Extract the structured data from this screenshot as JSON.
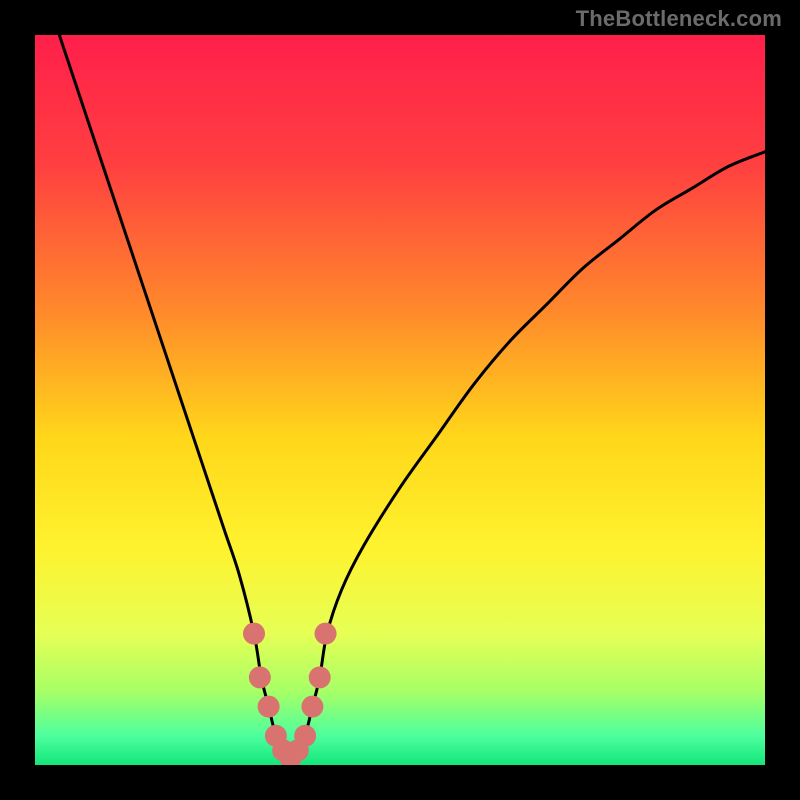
{
  "branding": {
    "text": "TheBottleneck.com"
  },
  "chart_data": {
    "type": "line",
    "title": "",
    "xlabel": "",
    "ylabel": "",
    "xlim": [
      0,
      100
    ],
    "ylim": [
      0,
      100
    ],
    "x": [
      0,
      2,
      4,
      6,
      8,
      10,
      12,
      14,
      16,
      18,
      20,
      22,
      24,
      26,
      28,
      30,
      31,
      32,
      33,
      34,
      35,
      36,
      37,
      38,
      39,
      40,
      42,
      45,
      50,
      55,
      60,
      65,
      70,
      75,
      80,
      85,
      90,
      95,
      100
    ],
    "values": [
      110,
      104,
      98,
      92,
      86,
      80,
      74,
      68,
      62,
      56,
      50,
      44,
      38,
      32,
      26,
      18,
      12,
      8,
      4,
      2,
      1,
      2,
      4,
      8,
      12,
      18,
      24,
      30,
      38,
      45,
      52,
      58,
      63,
      68,
      72,
      76,
      79,
      82,
      84
    ],
    "marker_points": {
      "x": [
        30,
        30.8,
        32,
        33,
        34,
        35,
        36,
        37,
        38,
        39,
        39.8
      ],
      "y": [
        18,
        12,
        8,
        4,
        2,
        1,
        2,
        4,
        8,
        12,
        18
      ]
    },
    "background_gradient": {
      "direction": "top-to-bottom",
      "stops": [
        {
          "offset": 0.0,
          "color": "#ff1f4b"
        },
        {
          "offset": 0.18,
          "color": "#ff4040"
        },
        {
          "offset": 0.38,
          "color": "#ff8a2b"
        },
        {
          "offset": 0.55,
          "color": "#ffd61a"
        },
        {
          "offset": 0.7,
          "color": "#fff22e"
        },
        {
          "offset": 0.82,
          "color": "#e6ff55"
        },
        {
          "offset": 0.9,
          "color": "#a6ff66"
        },
        {
          "offset": 0.96,
          "color": "#4dff9e"
        },
        {
          "offset": 1.0,
          "color": "#14e57a"
        }
      ]
    },
    "marker_color": "#d9736f",
    "curve_color": "#000000"
  }
}
